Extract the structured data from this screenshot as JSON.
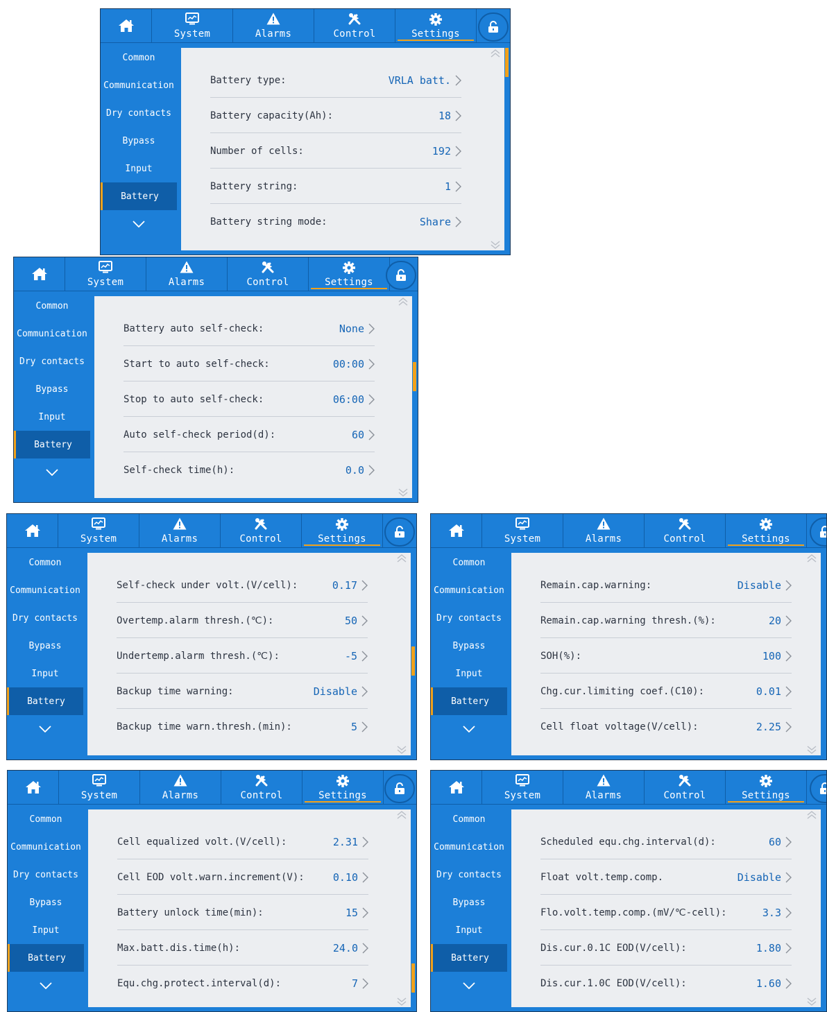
{
  "nav": {
    "tabs": [
      {
        "label": "System",
        "icon": "chart-monitor-icon"
      },
      {
        "label": "Alarms",
        "icon": "warning-triangle-icon"
      },
      {
        "label": "Control",
        "icon": "tools-icon"
      },
      {
        "label": "Settings",
        "icon": "gear-icon"
      }
    ],
    "active_tab": "Settings"
  },
  "sidebar": {
    "items": [
      "Common",
      "Communication",
      "Dry contacts",
      "Bypass",
      "Input",
      "Battery"
    ],
    "active": "Battery"
  },
  "screens": [
    {
      "rows": [
        {
          "label": "Battery type:",
          "value": "VRLA batt."
        },
        {
          "label": "Battery capacity(Ah):",
          "value": "18"
        },
        {
          "label": "Number of cells:",
          "value": "192"
        },
        {
          "label": "Battery string:",
          "value": "1"
        },
        {
          "label": "Battery string mode:",
          "value": "Share"
        }
      ]
    },
    {
      "rows": [
        {
          "label": "Battery auto self-check:",
          "value": "None"
        },
        {
          "label": "Start to auto self-check:",
          "value": "00:00"
        },
        {
          "label": "Stop to auto self-check:",
          "value": "06:00"
        },
        {
          "label": "Auto self-check period(d):",
          "value": "60"
        },
        {
          "label": "Self-check time(h):",
          "value": "0.0"
        }
      ]
    },
    {
      "rows": [
        {
          "label": "Self-check under volt.(V/cell):",
          "value": "0.17"
        },
        {
          "label": "Overtemp.alarm thresh.(℃):",
          "value": "50"
        },
        {
          "label": "Undertemp.alarm thresh.(℃):",
          "value": "-5"
        },
        {
          "label": "Backup time warning:",
          "value": "Disable"
        },
        {
          "label": "Backup time warn.thresh.(min):",
          "value": "5"
        }
      ]
    },
    {
      "rows": [
        {
          "label": "Remain.cap.warning:",
          "value": "Disable"
        },
        {
          "label": "Remain.cap.warning thresh.(%):",
          "value": "20"
        },
        {
          "label": "SOH(%):",
          "value": "100"
        },
        {
          "label": "Chg.cur.limiting coef.(C10):",
          "value": "0.01"
        },
        {
          "label": "Cell float voltage(V/cell):",
          "value": "2.25"
        }
      ]
    },
    {
      "rows": [
        {
          "label": "Cell equalized volt.(V/cell):",
          "value": "2.31"
        },
        {
          "label": "Cell EOD volt.warn.increment(V):",
          "value": "0.10"
        },
        {
          "label": "Battery unlock time(min):",
          "value": "15"
        },
        {
          "label": "Max.batt.dis.time(h):",
          "value": "24.0"
        },
        {
          "label": "Equ.chg.protect.interval(d):",
          "value": "7"
        }
      ]
    },
    {
      "rows": [
        {
          "label": "Scheduled equ.chg.interval(d):",
          "value": "60"
        },
        {
          "label": "Float volt.temp.comp.",
          "value": "Disable"
        },
        {
          "label": "Flo.volt.temp.comp.(mV/℃-cell):",
          "value": "3.3"
        },
        {
          "label": "Dis.cur.0.1C EOD(V/cell):",
          "value": "1.80"
        },
        {
          "label": "Dis.cur.1.0C EOD(V/cell):",
          "value": "1.60"
        }
      ]
    }
  ]
}
